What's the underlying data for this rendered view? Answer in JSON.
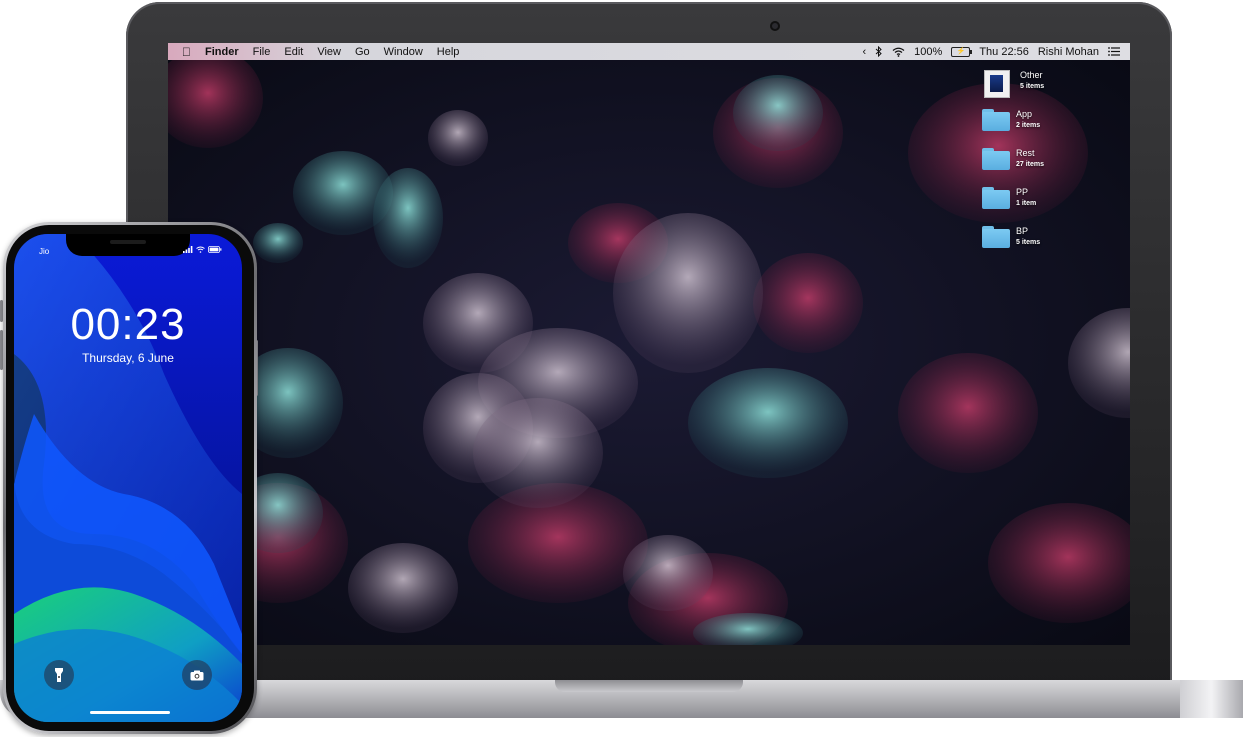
{
  "mac": {
    "menubar": {
      "app_name": "Finder",
      "menus": [
        "File",
        "Edit",
        "View",
        "Go",
        "Window",
        "Help"
      ],
      "battery_percent": "100%",
      "datetime": "Thu 22:56",
      "user": "Rishi Mohan"
    },
    "desktop_items": [
      {
        "name": "Other",
        "count": "5 items",
        "icon": "document-icon"
      },
      {
        "name": "App",
        "count": "2 items",
        "icon": "folder-icon"
      },
      {
        "name": "Rest",
        "count": "27 items",
        "icon": "folder-icon"
      },
      {
        "name": "PP",
        "count": "1 item",
        "icon": "folder-icon"
      },
      {
        "name": "BP",
        "count": "5 items",
        "icon": "folder-icon"
      }
    ],
    "wallpaper": "jellyfish",
    "colors": {
      "menubar": "#dedee3",
      "folder": "#6fbfe9",
      "wallpaper_bg": "#0d0f1c"
    }
  },
  "iphone": {
    "carrier": "Jio",
    "time": "00:23",
    "date": "Thursday, 6 June",
    "icons": [
      "flashlight-icon",
      "camera-icon"
    ]
  }
}
